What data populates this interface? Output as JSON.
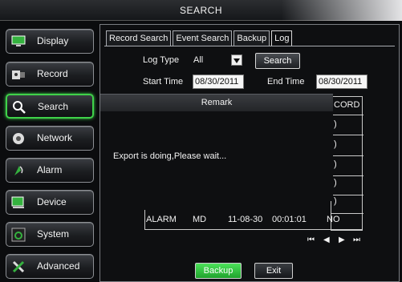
{
  "window": {
    "title": "SEARCH"
  },
  "sidebar": {
    "items": [
      {
        "label": "Display",
        "icon": "monitor-icon",
        "active": false
      },
      {
        "label": "Record",
        "icon": "record-icon",
        "active": false
      },
      {
        "label": "Search",
        "icon": "search-icon",
        "active": true
      },
      {
        "label": "Network",
        "icon": "network-icon",
        "active": false
      },
      {
        "label": "Alarm",
        "icon": "alarm-icon",
        "active": false
      },
      {
        "label": "Device",
        "icon": "device-icon",
        "active": false
      },
      {
        "label": "System",
        "icon": "system-icon",
        "active": false
      },
      {
        "label": "Advanced",
        "icon": "tools-icon",
        "active": false
      }
    ]
  },
  "tabs": [
    {
      "label": "Record Search",
      "active": false
    },
    {
      "label": "Event Search",
      "active": false
    },
    {
      "label": "Backup",
      "active": false
    },
    {
      "label": "Log",
      "active": true
    }
  ],
  "filters": {
    "log_type_label": "Log Type",
    "log_type_value": "All",
    "search_label": "Search",
    "start_time_label": "Start Time",
    "start_time_value": "08/30/2011",
    "end_time_label": "End Time",
    "end_time_value": "08/30/2011"
  },
  "overlay": {
    "title": "Remark",
    "message": "Export is doing,Please wait..."
  },
  "table": {
    "header_fragment": "CORD",
    "cell_fragments": [
      ")",
      ")",
      ")",
      ")",
      ")"
    ],
    "visible_row": {
      "type": "ALARM",
      "subtype": "MD",
      "date": "11-08-30",
      "time": "00:01:01",
      "record": "NO"
    }
  },
  "pager": {
    "first": "⏮",
    "prev": "◀",
    "next": "▶",
    "last": "⏭"
  },
  "footer": {
    "backup_label": "Backup",
    "exit_label": "Exit"
  },
  "colors": {
    "accent_green": "#3fd24a",
    "backup_button": "#2fbf3c",
    "field_bg": "#f6f6f6"
  }
}
